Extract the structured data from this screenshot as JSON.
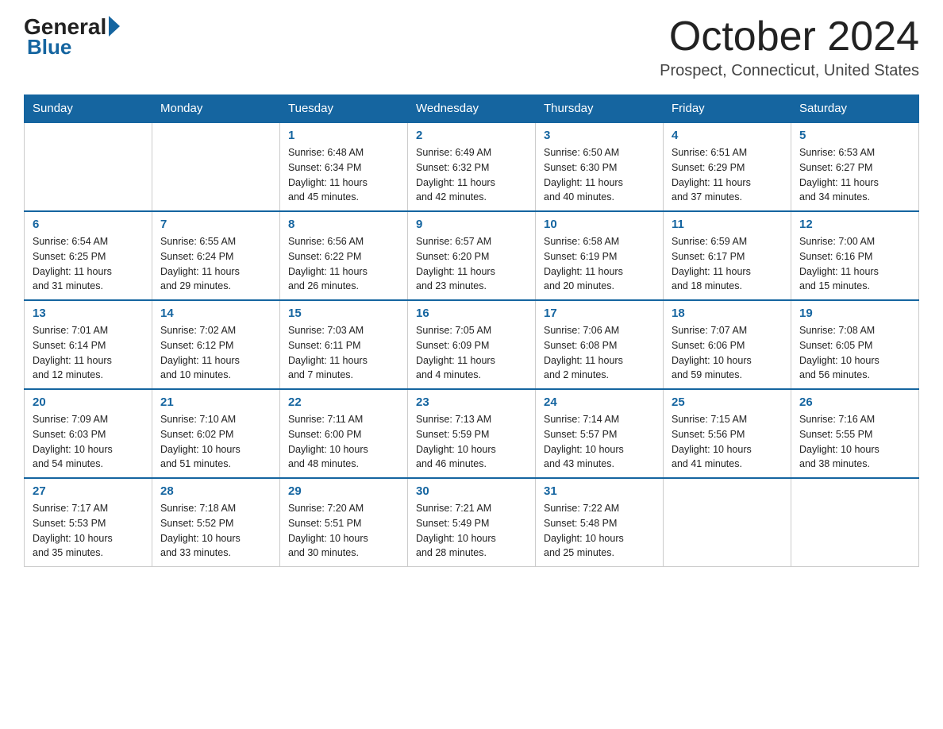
{
  "header": {
    "logo_general": "General",
    "logo_blue": "Blue",
    "month_title": "October 2024",
    "location": "Prospect, Connecticut, United States"
  },
  "columns": [
    "Sunday",
    "Monday",
    "Tuesday",
    "Wednesday",
    "Thursday",
    "Friday",
    "Saturday"
  ],
  "weeks": [
    [
      {
        "day": "",
        "info": ""
      },
      {
        "day": "",
        "info": ""
      },
      {
        "day": "1",
        "info": "Sunrise: 6:48 AM\nSunset: 6:34 PM\nDaylight: 11 hours\nand 45 minutes."
      },
      {
        "day": "2",
        "info": "Sunrise: 6:49 AM\nSunset: 6:32 PM\nDaylight: 11 hours\nand 42 minutes."
      },
      {
        "day": "3",
        "info": "Sunrise: 6:50 AM\nSunset: 6:30 PM\nDaylight: 11 hours\nand 40 minutes."
      },
      {
        "day": "4",
        "info": "Sunrise: 6:51 AM\nSunset: 6:29 PM\nDaylight: 11 hours\nand 37 minutes."
      },
      {
        "day": "5",
        "info": "Sunrise: 6:53 AM\nSunset: 6:27 PM\nDaylight: 11 hours\nand 34 minutes."
      }
    ],
    [
      {
        "day": "6",
        "info": "Sunrise: 6:54 AM\nSunset: 6:25 PM\nDaylight: 11 hours\nand 31 minutes."
      },
      {
        "day": "7",
        "info": "Sunrise: 6:55 AM\nSunset: 6:24 PM\nDaylight: 11 hours\nand 29 minutes."
      },
      {
        "day": "8",
        "info": "Sunrise: 6:56 AM\nSunset: 6:22 PM\nDaylight: 11 hours\nand 26 minutes."
      },
      {
        "day": "9",
        "info": "Sunrise: 6:57 AM\nSunset: 6:20 PM\nDaylight: 11 hours\nand 23 minutes."
      },
      {
        "day": "10",
        "info": "Sunrise: 6:58 AM\nSunset: 6:19 PM\nDaylight: 11 hours\nand 20 minutes."
      },
      {
        "day": "11",
        "info": "Sunrise: 6:59 AM\nSunset: 6:17 PM\nDaylight: 11 hours\nand 18 minutes."
      },
      {
        "day": "12",
        "info": "Sunrise: 7:00 AM\nSunset: 6:16 PM\nDaylight: 11 hours\nand 15 minutes."
      }
    ],
    [
      {
        "day": "13",
        "info": "Sunrise: 7:01 AM\nSunset: 6:14 PM\nDaylight: 11 hours\nand 12 minutes."
      },
      {
        "day": "14",
        "info": "Sunrise: 7:02 AM\nSunset: 6:12 PM\nDaylight: 11 hours\nand 10 minutes."
      },
      {
        "day": "15",
        "info": "Sunrise: 7:03 AM\nSunset: 6:11 PM\nDaylight: 11 hours\nand 7 minutes."
      },
      {
        "day": "16",
        "info": "Sunrise: 7:05 AM\nSunset: 6:09 PM\nDaylight: 11 hours\nand 4 minutes."
      },
      {
        "day": "17",
        "info": "Sunrise: 7:06 AM\nSunset: 6:08 PM\nDaylight: 11 hours\nand 2 minutes."
      },
      {
        "day": "18",
        "info": "Sunrise: 7:07 AM\nSunset: 6:06 PM\nDaylight: 10 hours\nand 59 minutes."
      },
      {
        "day": "19",
        "info": "Sunrise: 7:08 AM\nSunset: 6:05 PM\nDaylight: 10 hours\nand 56 minutes."
      }
    ],
    [
      {
        "day": "20",
        "info": "Sunrise: 7:09 AM\nSunset: 6:03 PM\nDaylight: 10 hours\nand 54 minutes."
      },
      {
        "day": "21",
        "info": "Sunrise: 7:10 AM\nSunset: 6:02 PM\nDaylight: 10 hours\nand 51 minutes."
      },
      {
        "day": "22",
        "info": "Sunrise: 7:11 AM\nSunset: 6:00 PM\nDaylight: 10 hours\nand 48 minutes."
      },
      {
        "day": "23",
        "info": "Sunrise: 7:13 AM\nSunset: 5:59 PM\nDaylight: 10 hours\nand 46 minutes."
      },
      {
        "day": "24",
        "info": "Sunrise: 7:14 AM\nSunset: 5:57 PM\nDaylight: 10 hours\nand 43 minutes."
      },
      {
        "day": "25",
        "info": "Sunrise: 7:15 AM\nSunset: 5:56 PM\nDaylight: 10 hours\nand 41 minutes."
      },
      {
        "day": "26",
        "info": "Sunrise: 7:16 AM\nSunset: 5:55 PM\nDaylight: 10 hours\nand 38 minutes."
      }
    ],
    [
      {
        "day": "27",
        "info": "Sunrise: 7:17 AM\nSunset: 5:53 PM\nDaylight: 10 hours\nand 35 minutes."
      },
      {
        "day": "28",
        "info": "Sunrise: 7:18 AM\nSunset: 5:52 PM\nDaylight: 10 hours\nand 33 minutes."
      },
      {
        "day": "29",
        "info": "Sunrise: 7:20 AM\nSunset: 5:51 PM\nDaylight: 10 hours\nand 30 minutes."
      },
      {
        "day": "30",
        "info": "Sunrise: 7:21 AM\nSunset: 5:49 PM\nDaylight: 10 hours\nand 28 minutes."
      },
      {
        "day": "31",
        "info": "Sunrise: 7:22 AM\nSunset: 5:48 PM\nDaylight: 10 hours\nand 25 minutes."
      },
      {
        "day": "",
        "info": ""
      },
      {
        "day": "",
        "info": ""
      }
    ]
  ]
}
